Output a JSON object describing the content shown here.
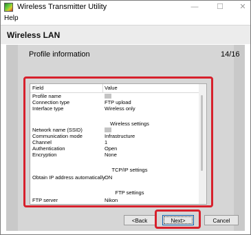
{
  "window": {
    "title": "Wireless Transmitter Utility",
    "minimize": "—",
    "maximize": "☐",
    "close": "✕"
  },
  "menu": {
    "help": "Help"
  },
  "header": {
    "title": "Wireless LAN"
  },
  "page": {
    "title": "Profile information",
    "count": "14/16"
  },
  "table": {
    "col_field": "Field",
    "col_value": "Value",
    "rows": [
      {
        "field": "Profile name",
        "value": ""
      },
      {
        "field": "Connection type",
        "value": "FTP upload"
      },
      {
        "field": "Interface type",
        "value": "Wireless only"
      },
      {
        "section": "Wireless settings"
      },
      {
        "field": "Network name (SSID)",
        "value": ""
      },
      {
        "field": "Communication mode",
        "value": "Infrastructure"
      },
      {
        "field": "Channel",
        "value": "1"
      },
      {
        "field": "Authentication",
        "value": "Open"
      },
      {
        "field": "Encryption",
        "value": "None"
      },
      {
        "section": "TCP/IP settings"
      },
      {
        "field": "Obtain IP address automatically",
        "value": "ON"
      },
      {
        "section": "FTP settings"
      },
      {
        "field": "FTP server",
        "value": "Nikon"
      }
    ]
  },
  "buttons": {
    "back": "<Back",
    "next": "Next>",
    "cancel": "Cancel"
  },
  "colors": {
    "highlight": "#d7202c"
  }
}
